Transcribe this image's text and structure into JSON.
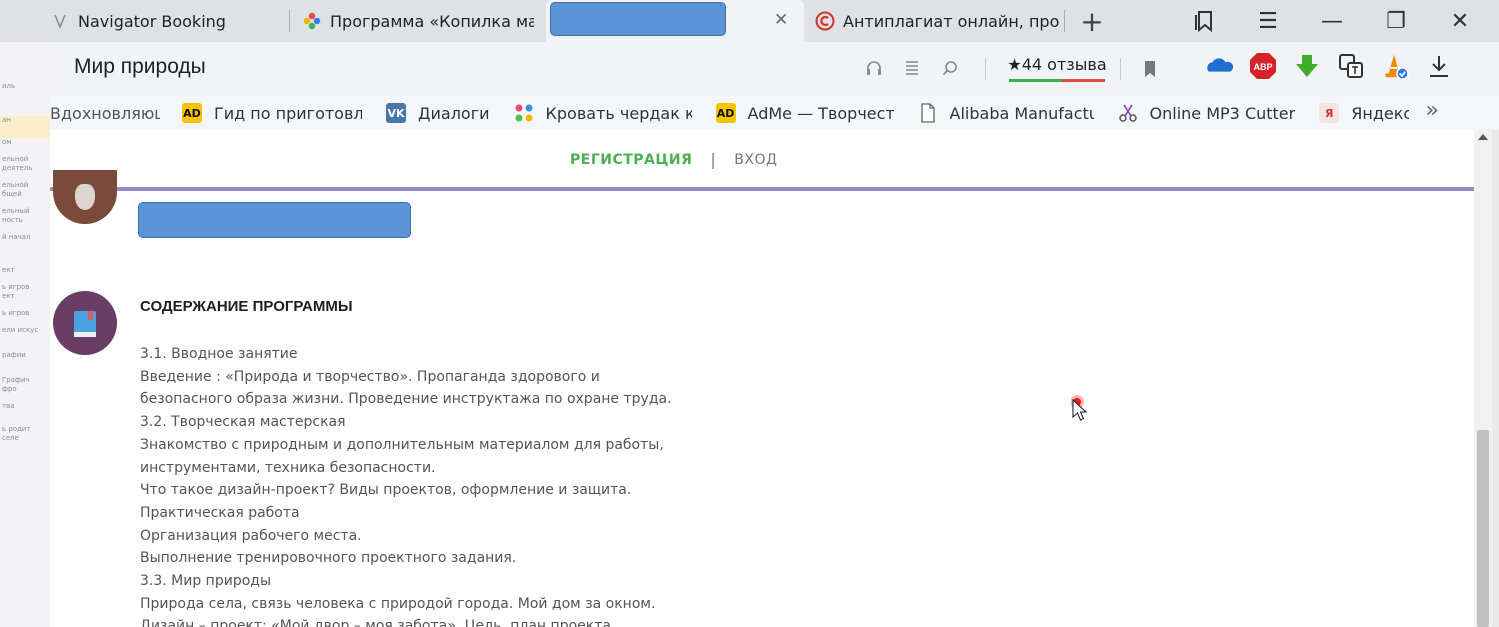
{
  "tabs": [
    {
      "label": "Navigator Booking",
      "icon": "app-icon"
    },
    {
      "label": "Программа «Копилка мас",
      "icon": "colorful-flower-icon"
    },
    {
      "label": "",
      "icon": "redacted",
      "active": true
    },
    {
      "label": "Антиплагиат онлайн, про",
      "icon": "copyright-c-icon"
    }
  ],
  "tab_close_symbol": "✕",
  "new_tab_symbol": "+",
  "window_controls": {
    "bookmarks": "bookmark-stack-icon",
    "menu": "☰",
    "minimize": "—",
    "restore": "❐",
    "close": "✕"
  },
  "address_bar": {
    "page_title": "Мир природы",
    "reviews_label": "★44 отзыва",
    "tools": [
      "headphones-icon",
      "reader-icon",
      "search-icon"
    ]
  },
  "extensions": [
    "onedrive-icon",
    "adblock-icon",
    "download-arrow-icon",
    "translate-icon",
    "vlc-icon",
    "download-icon"
  ],
  "adblock_label": "ABP",
  "bookmarks": [
    {
      "label": "Вдохновляющи",
      "icon": ""
    },
    {
      "label": "Гид по приготовле",
      "icon": "AD"
    },
    {
      "label": "Диалоги",
      "icon": "VK"
    },
    {
      "label": "Кровать чердак ку",
      "icon": "dots"
    },
    {
      "label": "AdMe — Творчест",
      "icon": "AD"
    },
    {
      "label": "Alibaba Manufactu",
      "icon": "page"
    },
    {
      "label": "Online MP3 Cutter",
      "icon": "scissors"
    },
    {
      "label": "Яндекс",
      "icon": "Я"
    }
  ],
  "bookmarks_more": "»",
  "site_nav": {
    "register": "РЕГИСТРАЦИЯ",
    "divider": "|",
    "login": "ВХОД"
  },
  "section": {
    "title": "СОДЕРЖАНИЕ ПРОГРАММЫ",
    "lines": [
      "3.1. Вводное занятие",
      "Введение : «Природа и творчество». Пропаганда здорового и",
      "безопасного образа жизни. Проведение инструктажа по охране труда.",
      "3.2. Творческая мастерская",
      "Знакомство с природным и дополнительным материалом для работы,",
      "инструментами, техника безопасности.",
      "Что такое дизайн-проект? Виды проектов, оформление и защита.",
      "Практическая работа",
      "Организация рабочего места.",
      "Выполнение тренировочного проектного задания.",
      "3.3. Мир природы",
      "Природа села, связь человека с природой города. Мой дом за окном.",
      "Дизайн – проект: «Мой двор – моя забота». Цель, план проекта."
    ]
  },
  "left_panel_items": [
    "иль",
    "",
    "ан",
    "ом",
    "ельной\nдеятель",
    "ельной\nбщей",
    "ельный\nность",
    "й начал",
    "ект",
    "ь игров\nект",
    "ь игров",
    "ели искус",
    "рафии",
    "Графич\nфро",
    "тва",
    "ь родит\nселе"
  ]
}
